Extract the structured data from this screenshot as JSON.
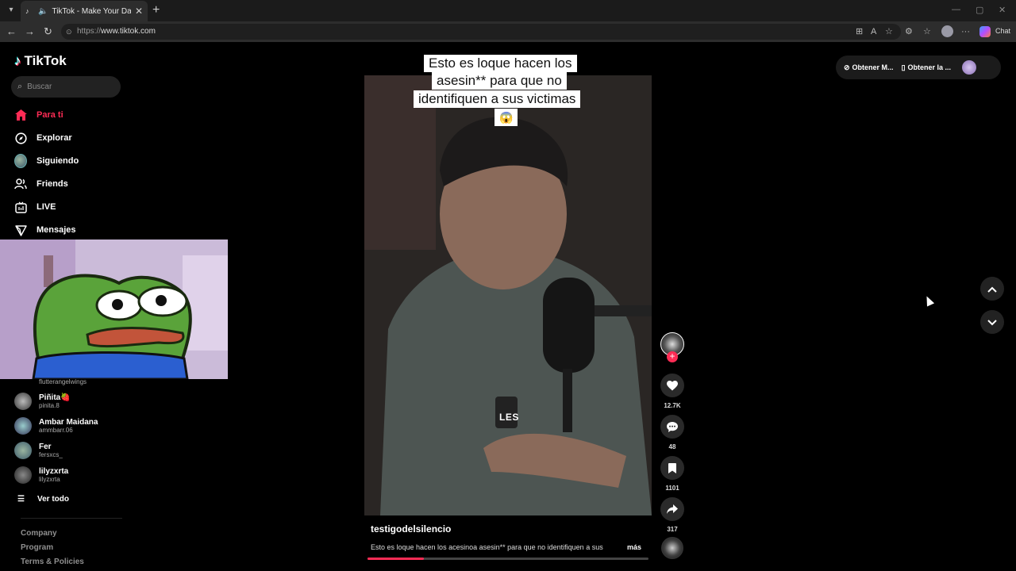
{
  "browser": {
    "tab_title": "TikTok - Make Your Day",
    "tab_close": "✕",
    "new_tab": "+",
    "url_prefix": "https://",
    "url_host": "www.tiktok.com",
    "chat_label": "Chat"
  },
  "sidebar": {
    "brand": "TikTok",
    "search_placeholder": "Buscar",
    "nav": [
      {
        "label": "Para ti",
        "icon": "home-icon",
        "active": true
      },
      {
        "label": "Explorar",
        "icon": "compass-icon"
      },
      {
        "label": "Siguiendo",
        "icon": "avatar-icon"
      },
      {
        "label": "Friends",
        "icon": "friends-icon"
      },
      {
        "label": "LIVE",
        "icon": "live-tv-icon"
      },
      {
        "label": "Mensajes",
        "icon": "send-icon"
      }
    ],
    "following_first_handle": "flutterangelwings",
    "following": [
      {
        "name": "Piñita🍓",
        "handle": "pinita.8"
      },
      {
        "name": "Ambar Maidana",
        "handle": "ammbarr.06"
      },
      {
        "name": "Fer",
        "handle": "fersxcs_"
      },
      {
        "name": "lilyzxrta",
        "handle": "lilyzxrta"
      }
    ],
    "see_all": "Ver todo",
    "footer": [
      "Company",
      "Program",
      "Terms & Policies"
    ]
  },
  "video": {
    "caption_lines": [
      "Esto es loque hacen los",
      "asesin** para que no",
      "identifiquen a sus victimas",
      "😱"
    ],
    "subtitle_word": "LES",
    "author": "testigodelsilencio",
    "description": "Esto es loque hacen los acesinoa asesin** para que no identifiquen a sus",
    "more": "más",
    "progress": 0.2
  },
  "actions": {
    "likes": "12.7K",
    "comments": "48",
    "saves": "1101",
    "shares": "317"
  },
  "topbar": {
    "coins_label": "Obtener M...",
    "app_label": "Obtener la ..."
  }
}
